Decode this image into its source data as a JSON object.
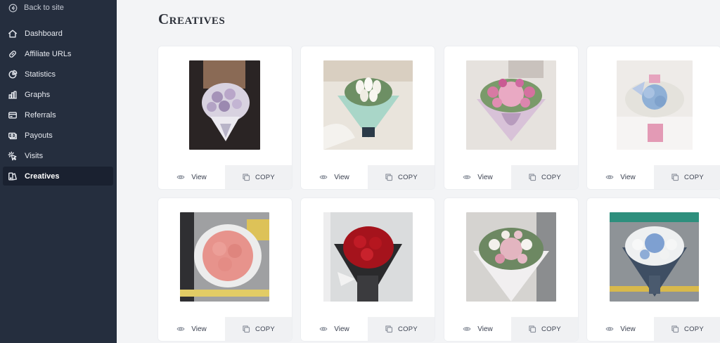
{
  "sidebar": {
    "back_label": "Back to site",
    "items": [
      {
        "label": "Dashboard",
        "icon": "house-icon"
      },
      {
        "label": "Affiliate URLs",
        "icon": "link-icon"
      },
      {
        "label": "Statistics",
        "icon": "pie-chart-icon"
      },
      {
        "label": "Graphs",
        "icon": "bar-chart-icon"
      },
      {
        "label": "Referrals",
        "icon": "credit-card-icon"
      },
      {
        "label": "Payouts",
        "icon": "cash-icon"
      },
      {
        "label": "Visits",
        "icon": "cursor-click-icon"
      },
      {
        "label": "Creatives",
        "icon": "creatives-icon",
        "active": true
      }
    ]
  },
  "page": {
    "title": "Creatives"
  },
  "creatives": [
    {
      "view_label": "View",
      "copy_label": "COPY",
      "image": "purple-rose-bouquet"
    },
    {
      "view_label": "View",
      "copy_label": "COPY",
      "image": "white-tulip-mint-bouquet"
    },
    {
      "view_label": "View",
      "copy_label": "COPY",
      "image": "pink-hydrangea-rose-bouquet"
    },
    {
      "view_label": "View",
      "copy_label": "COPY",
      "image": "blue-hydrangea-babys-breath-bouquet"
    },
    {
      "view_label": "View",
      "copy_label": "COPY",
      "image": "coral-rose-bouquet"
    },
    {
      "view_label": "View",
      "copy_label": "COPY",
      "image": "red-rose-black-wrap-bouquet"
    },
    {
      "view_label": "View",
      "copy_label": "COPY",
      "image": "pink-white-mixed-bouquet"
    },
    {
      "view_label": "View",
      "copy_label": "COPY",
      "image": "blue-white-rose-bouquet"
    }
  ],
  "colors": {
    "sidebar_bg": "#252e3e",
    "sidebar_active_bg": "#1a2130",
    "page_bg": "#f3f4f6",
    "card_bg": "#ffffff",
    "copy_bg": "#f0f1f3"
  }
}
